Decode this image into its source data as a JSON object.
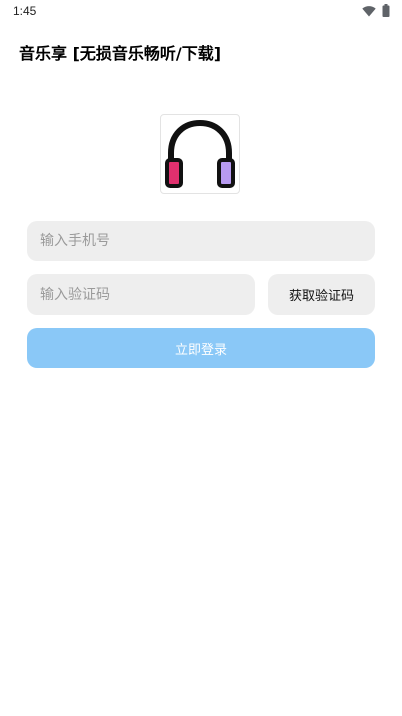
{
  "status_bar": {
    "time": "1:45",
    "icons": [
      "wifi-icon",
      "battery-icon"
    ]
  },
  "header": {
    "title": "音乐享 [无损音乐畅听/下载]"
  },
  "logo": {
    "icon": "headphones-icon",
    "colors": {
      "band": "#111111",
      "left_cup": "#e0306e",
      "right_cup": "#b79af0"
    }
  },
  "form": {
    "phone_placeholder": "输入手机号",
    "phone_value": "",
    "code_placeholder": "输入验证码",
    "code_value": "",
    "get_code_label": "获取验证码",
    "login_label": "立即登录"
  },
  "colors": {
    "field_bg": "#eeeeee",
    "login_bg": "#8ac8f7",
    "login_text": "#ffffff"
  }
}
